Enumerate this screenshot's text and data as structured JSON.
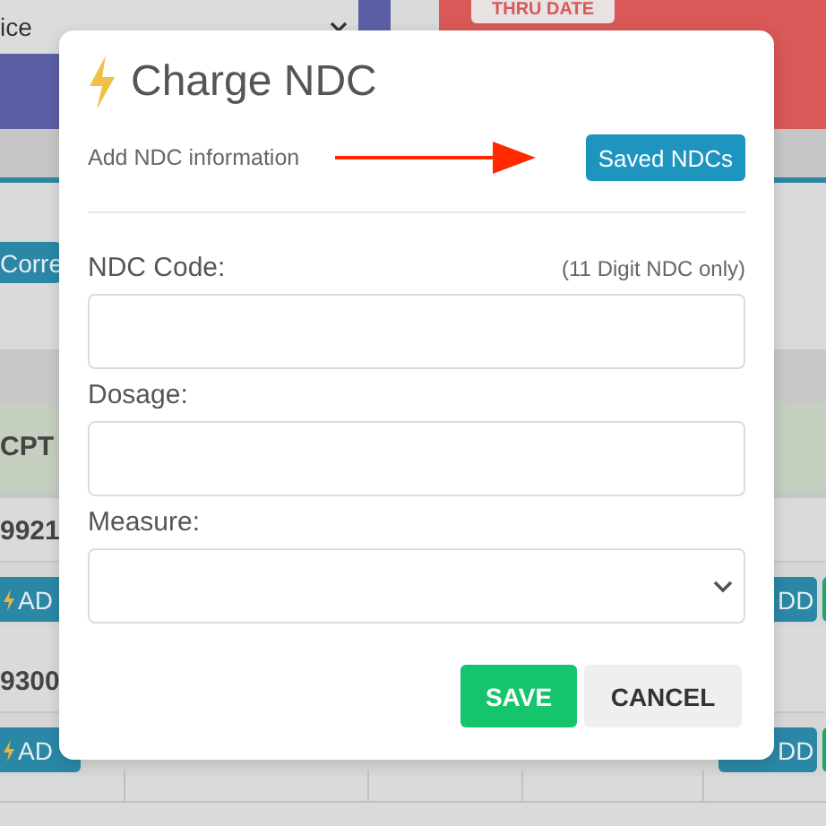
{
  "background": {
    "select_value": "ice",
    "badge": "THRU DATE",
    "button": "Corre",
    "column_header": "CPT",
    "rows": [
      {
        "code": "9921",
        "add_button": "AD",
        "right_button": "DD"
      },
      {
        "code": "9300",
        "add_button": "AD",
        "right_button": "DD"
      }
    ]
  },
  "dialog": {
    "title": "Charge NDC",
    "subtitle": "Add NDC information",
    "saved_button": "Saved NDCs",
    "fields": [
      {
        "kind": "input",
        "label": "NDC Code:",
        "hint": "(11 Digit NDC only)"
      },
      {
        "kind": "input",
        "label": "Dosage:"
      },
      {
        "kind": "select",
        "label": "Measure:"
      }
    ],
    "buttons": [
      {
        "kind": "primary",
        "label": "SAVE"
      },
      {
        "kind": "secondary",
        "label": "CANCEL"
      }
    ]
  }
}
